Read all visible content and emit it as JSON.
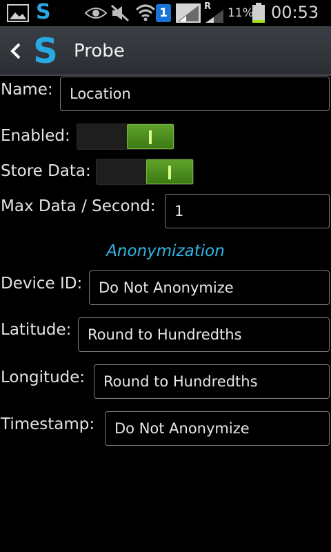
{
  "status_bar": {
    "battery_percent": "11%",
    "time": "00:53",
    "network_type": "R",
    "notification_count": "1",
    "icons": [
      "gallery-icon",
      "app-s-icon",
      "eye-icon",
      "mute-icon",
      "wifi-icon",
      "notification-badge-icon",
      "signal-icon",
      "roaming-signal-icon",
      "battery-icon"
    ],
    "battery_color": "#a4e21e"
  },
  "action_bar": {
    "logo": "S",
    "title": "Probe",
    "logo_color": "#27a9e1"
  },
  "form": {
    "name_label": "Name:",
    "name_value": "Location",
    "enabled_label": "Enabled:",
    "enabled_on": true,
    "store_label": "Store Data:",
    "store_on": true,
    "max_label": "Max Data / Second:",
    "max_value": "1"
  },
  "anonymization": {
    "header": "Anonymization",
    "device_label": "Device ID:",
    "device_value": "Do Not Anonymize",
    "lat_label": "Latitude:",
    "lat_value": "Round to Hundredths",
    "lon_label": "Longitude:",
    "lon_value": "Round to Hundredths",
    "ts_label": "Timestamp:",
    "ts_value": "Do Not Anonymize"
  },
  "colors": {
    "accent": "#33b5e5",
    "toggle_on": "#4e8f1f"
  }
}
